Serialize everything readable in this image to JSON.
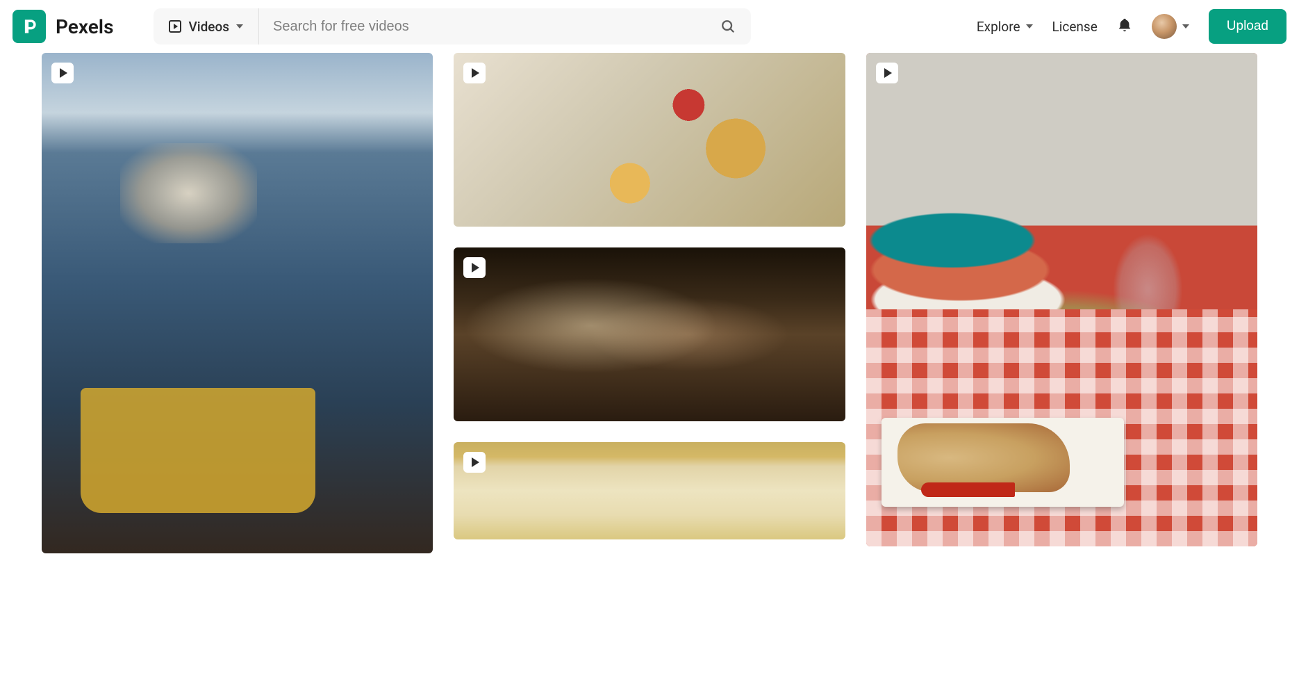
{
  "header": {
    "brand": "Pexels",
    "search_type": "Videos",
    "search_placeholder": "Search for free videos",
    "nav": {
      "explore": "Explore",
      "license": "License"
    },
    "upload_label": "Upload"
  },
  "gallery": {
    "columns": [
      {
        "items": [
          {
            "type": "video"
          }
        ]
      },
      {
        "items": [
          {
            "type": "video"
          },
          {
            "type": "video"
          },
          {
            "type": "video"
          }
        ]
      },
      {
        "items": [
          {
            "type": "video"
          }
        ]
      }
    ]
  },
  "colors": {
    "brand": "#07A081"
  }
}
